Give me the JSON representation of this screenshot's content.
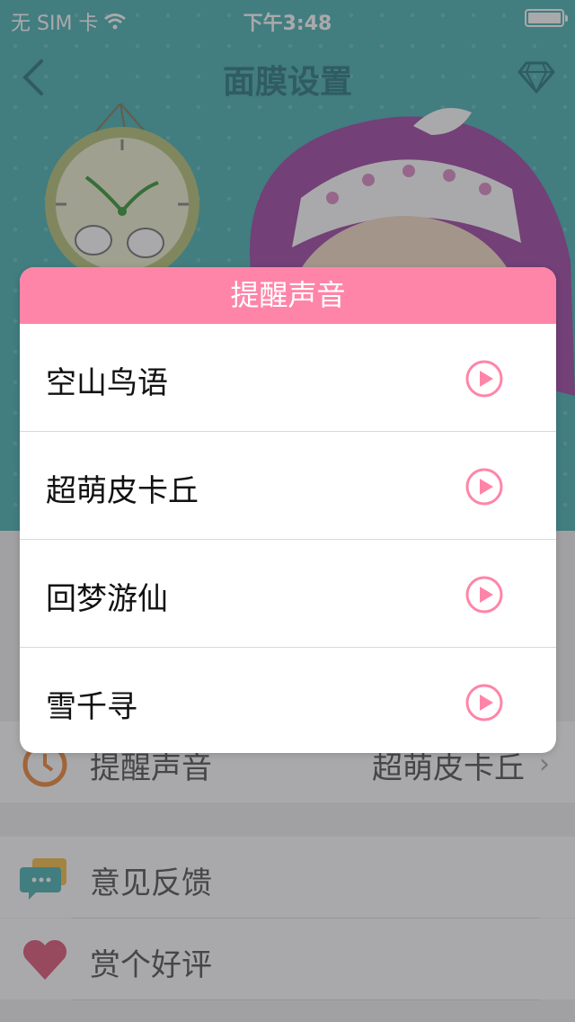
{
  "status_bar": {
    "carrier": "无 SIM 卡",
    "time": "下午3:48"
  },
  "nav": {
    "title": "面膜设置"
  },
  "settings": {
    "reminder_sound_label": "提醒声音",
    "reminder_sound_value": "超萌皮卡丘",
    "feedback_label": "意见反馈",
    "rate_label": "赏个好评"
  },
  "dialog": {
    "title": "提醒声音",
    "options": [
      {
        "label": "空山鸟语"
      },
      {
        "label": "超萌皮卡丘"
      },
      {
        "label": "回梦游仙"
      },
      {
        "label": "雪千寻"
      }
    ]
  },
  "colors": {
    "accent_pink": "#ff85a8",
    "teal": "#4fb3b3"
  }
}
